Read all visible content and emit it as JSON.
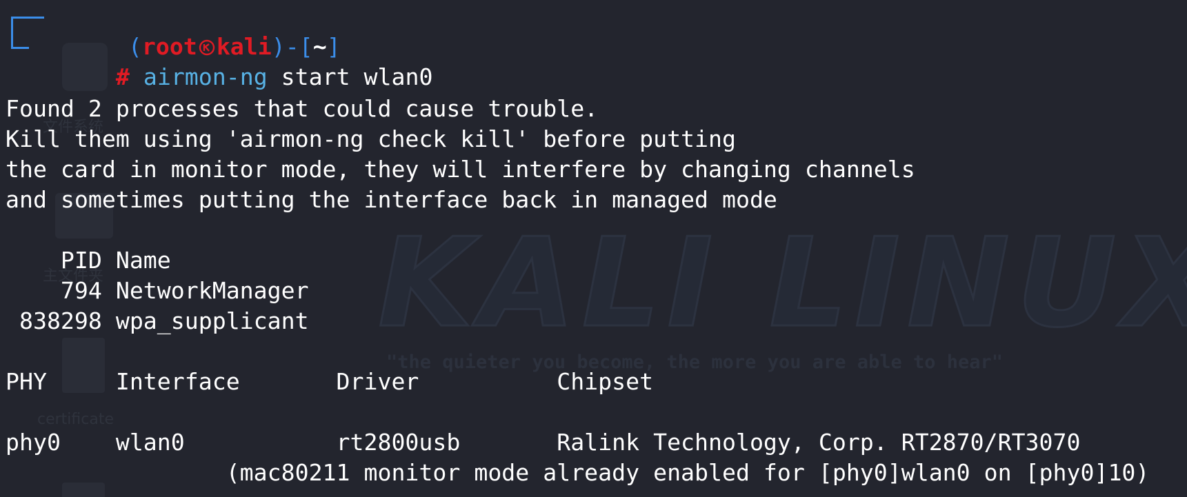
{
  "prompt": {
    "open_paren": "(",
    "user": "root",
    "host": "kali",
    "close_dash_bracket": ")-[",
    "cwd": "~",
    "close_bracket": "]",
    "hash": "#",
    "command_name": "airmon-ng",
    "command_args": " start wlan0"
  },
  "output": {
    "warning_lines": [
      "Found 2 processes that could cause trouble.",
      "Kill them using 'airmon-ng check kill' before putting",
      "the card in monitor mode, they will interfere by changing channels",
      "and sometimes putting the interface back in managed mode"
    ],
    "process_header": "    PID Name",
    "processes": [
      "    794 NetworkManager",
      " 838298 wpa_supplicant"
    ],
    "iface_header": "PHY\tInterface\tDriver\t\tChipset",
    "iface_header_display": "PHY     Interface       Driver          Chipset",
    "iface_row_display": "phy0    wlan0           rt2800usb       Ralink Technology, Corp. RT2870/RT3070",
    "monitor_note": "                (mac80211 monitor mode already enabled for [phy0]wlan0 on [phy0]10)"
  },
  "wallpaper": {
    "title": "KALI LINUX",
    "tagline": "\"the quieter you become, the more you are able to hear\"",
    "desktop_labels": [
      "文件系统",
      "主文件夹",
      "certificate"
    ]
  },
  "colors": {
    "background": "#23252e",
    "prompt_frame": "#3b8eea",
    "user_host": "#e01b24",
    "command": "#58b2e5",
    "text": "#ffffff"
  }
}
